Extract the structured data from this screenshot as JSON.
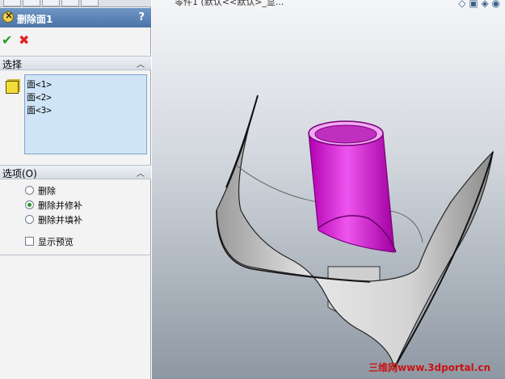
{
  "panel": {
    "title": "删除面1",
    "help": "?",
    "selection_header": "选择",
    "faces": [
      "面<1>",
      "面<2>",
      "面<3>"
    ],
    "options_header": "选项(O)",
    "radio_options": [
      {
        "label": "删除",
        "selected": false
      },
      {
        "label": "删除并修补",
        "selected": true
      },
      {
        "label": "删除并填补",
        "selected": false
      }
    ],
    "preview_label": "显示预览",
    "preview_checked": false
  },
  "viewport": {
    "title": "零件1 (默认<<默认>_显...",
    "watermark": "三维网www.3dportal.cn"
  },
  "colors": {
    "title_bar": "#5a80b4",
    "selection_highlight": "#d400d4",
    "surface": "#d6d6d6",
    "ok": "#2a9a2a",
    "cancel": "#d22222"
  }
}
